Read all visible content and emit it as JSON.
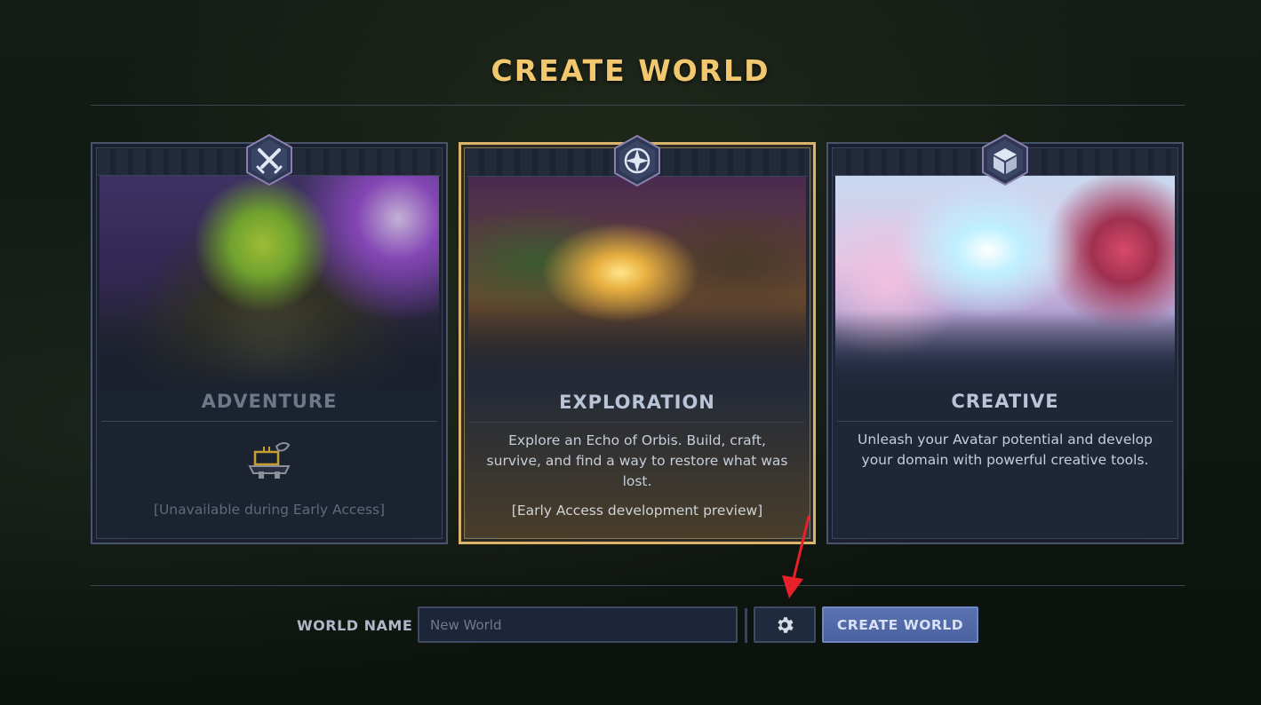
{
  "page": {
    "title": "CREATE WORLD"
  },
  "modes": [
    {
      "name": "ADVENTURE",
      "icon": "crossed-swords-icon",
      "description": "",
      "note": "[Unavailable during Early Access]",
      "state": "disabled"
    },
    {
      "name": "EXPLORATION",
      "icon": "compass-star-icon",
      "description": "Explore an Echo of Orbis. Build, craft, survive, and find a way to restore what was lost.",
      "note": "[Early Access development preview]",
      "state": "selected"
    },
    {
      "name": "CREATIVE",
      "icon": "cube-icon",
      "description": "Unleash your Avatar potential and develop your domain with powerful creative tools.",
      "note": "",
      "state": "normal"
    }
  ],
  "world_name": {
    "label": "WORLD NAME",
    "placeholder": "New World",
    "value": ""
  },
  "actions": {
    "settings_icon": "gear-icon",
    "create_label": "CREATE WORLD"
  },
  "colors": {
    "title_gold": "#f1c86f",
    "selected_border": "#d9b46a",
    "primary_button": "#4a62a0",
    "annotation_arrow": "#e8202a"
  }
}
